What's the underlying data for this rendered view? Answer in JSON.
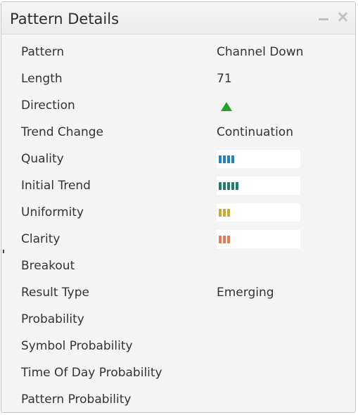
{
  "panel": {
    "title": "Pattern Details"
  },
  "rows": [
    {
      "label": "Pattern",
      "value": "Channel Down"
    },
    {
      "label": "Length",
      "value": "71"
    },
    {
      "label": "Direction",
      "icon": "up-arrow-icon",
      "icon_color": "#22a322"
    },
    {
      "label": "Trend Change",
      "value": "Continuation"
    },
    {
      "label": "Quality",
      "meter": {
        "level": 4,
        "color": "#1e7fd8"
      }
    },
    {
      "label": "Initial Trend",
      "meter": {
        "level": 5,
        "color": "#1e7f6c"
      }
    },
    {
      "label": "Uniformity",
      "meter": {
        "level": 3,
        "color": "#cfa92f"
      }
    },
    {
      "label": "Clarity",
      "meter": {
        "level": 3,
        "color": "#ef7a4c"
      }
    },
    {
      "label": "Breakout",
      "value": ""
    },
    {
      "label": "Result Type",
      "value": "Emerging"
    },
    {
      "label": "Probability",
      "value": ""
    },
    {
      "label": "Symbol Probability",
      "value": ""
    },
    {
      "label": "Time Of Day Probability",
      "value": ""
    },
    {
      "label": "Pattern Probability",
      "value": ""
    }
  ]
}
